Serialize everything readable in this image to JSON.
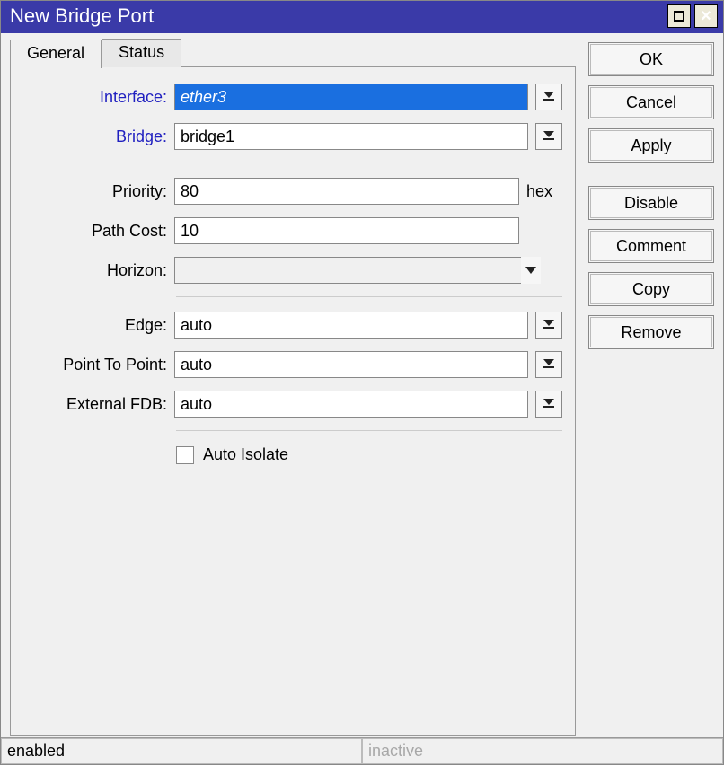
{
  "window": {
    "title": "New Bridge Port"
  },
  "tabs": {
    "general": "General",
    "status": "Status"
  },
  "fields": {
    "interface_label": "Interface:",
    "interface_value": "ether3",
    "bridge_label": "Bridge:",
    "bridge_value": "bridge1",
    "priority_label": "Priority:",
    "priority_value": "80",
    "priority_suffix": "hex",
    "pathcost_label": "Path Cost:",
    "pathcost_value": "10",
    "horizon_label": "Horizon:",
    "horizon_value": "",
    "edge_label": "Edge:",
    "edge_value": "auto",
    "ptp_label": "Point To Point:",
    "ptp_value": "auto",
    "extfdb_label": "External FDB:",
    "extfdb_value": "auto",
    "autoisolate_label": "Auto Isolate"
  },
  "buttons": {
    "ok": "OK",
    "cancel": "Cancel",
    "apply": "Apply",
    "disable": "Disable",
    "comment": "Comment",
    "copy": "Copy",
    "remove": "Remove"
  },
  "status": {
    "left": "enabled",
    "right": "inactive"
  }
}
